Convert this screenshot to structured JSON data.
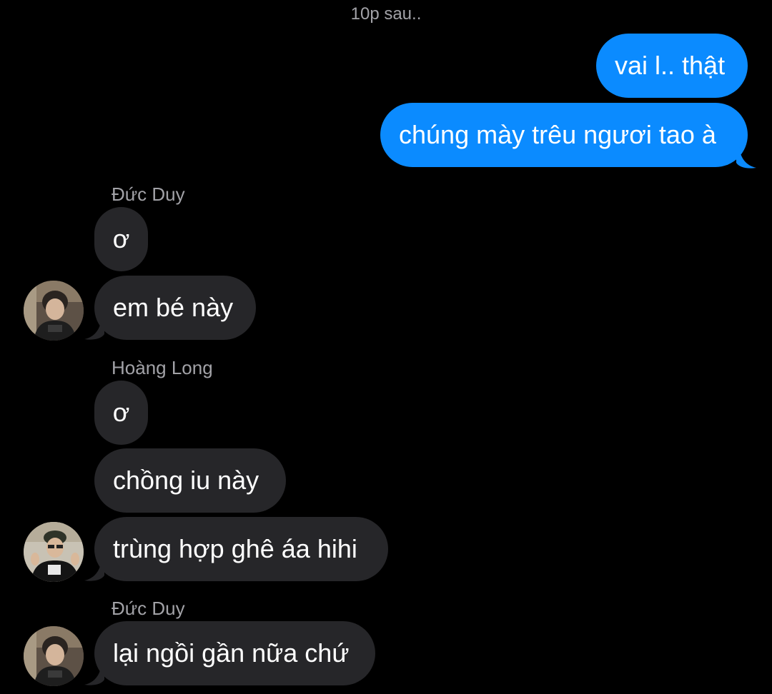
{
  "timestamp": "10p sau..",
  "messages": {
    "out1": "vai l.. thật",
    "out2": "chúng mày trêu ngươi tao à",
    "sender1": "Đức Duy",
    "in1": "ơ",
    "in2": "em bé này",
    "sender2": "Hoàng Long",
    "in3": "ơ",
    "in4": "chồng iu này",
    "in5": "trùng hợp ghê áa hihi",
    "sender3": "Đức Duy",
    "in6": "lại ngồi gần nữa chứ"
  },
  "colors": {
    "outgoing_bubble": "#0b8bff",
    "incoming_bubble": "#262629",
    "background": "#000000",
    "meta_text": "#a2a2a7"
  },
  "icons": {
    "avatar_duc_duy": "avatar-duc-duy",
    "avatar_hoang_long": "avatar-hoang-long"
  }
}
